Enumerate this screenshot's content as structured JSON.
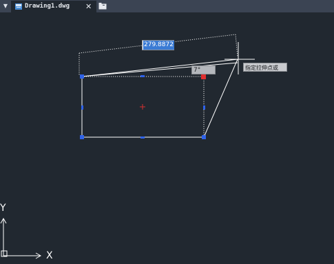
{
  "tabs": {
    "menu_glyph": "▼",
    "active": {
      "label": "Drawing1.dwg",
      "close_glyph": "✕",
      "icon": "dwg-file-icon"
    },
    "new_tab_icon": "new-tab-icon"
  },
  "canvas": {
    "background": "#212830",
    "dimension_value": "279.8872",
    "angle_value": "7°",
    "tooltip": "指定拉伸点或"
  },
  "ucs": {
    "y_label": "Y",
    "x_label": "X"
  },
  "colors": {
    "grip": "#2f62e8",
    "hot_grip": "#e03030",
    "geometry": "#ffffff",
    "center_mark": "#d83030"
  }
}
